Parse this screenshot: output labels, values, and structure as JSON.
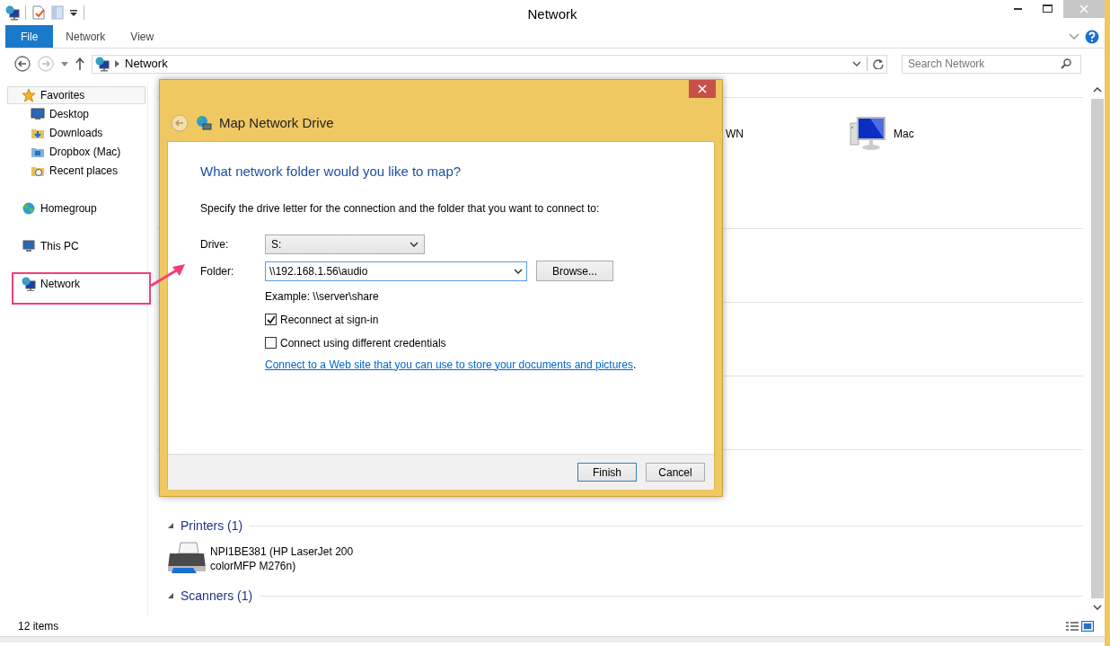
{
  "window": {
    "title": "Network"
  },
  "ribbon": {
    "tabs": [
      {
        "label": "File",
        "selected": true
      },
      {
        "label": "Network",
        "selected": false
      },
      {
        "label": "View",
        "selected": false
      }
    ]
  },
  "address_bar": {
    "location": "Network"
  },
  "search": {
    "placeholder": "Search Network"
  },
  "nav_pane": {
    "items": [
      {
        "label": "Favorites",
        "kind": "favorites",
        "selected": true,
        "children": [
          {
            "label": "Desktop",
            "kind": "desktop"
          },
          {
            "label": "Downloads",
            "kind": "downloads"
          },
          {
            "label": "Dropbox (Mac)",
            "kind": "dropbox"
          },
          {
            "label": "Recent places",
            "kind": "recent"
          }
        ]
      },
      {
        "label": "Homegroup",
        "kind": "homegroup",
        "selected": false
      },
      {
        "label": "This PC",
        "kind": "pc",
        "selected": false
      },
      {
        "label": "Network",
        "kind": "network",
        "selected": false
      }
    ]
  },
  "content": {
    "computers": [
      {
        "name": "WN",
        "kind": "text"
      },
      {
        "name": "Mac",
        "kind": "computer"
      }
    ],
    "groups": [
      {
        "title": "Printers (1)",
        "items": [
          {
            "name": "NPI1BE381 (HP LaserJet 200 colorMFP M276n)",
            "kind": "printer"
          }
        ]
      },
      {
        "title": "Scanners (1)"
      }
    ]
  },
  "status_bar": {
    "count": "12 items"
  },
  "dialog": {
    "title": "Map Network Drive",
    "heading": "What network folder would you like to map?",
    "instruction": "Specify the drive letter for the connection and the folder that you want to connect to:",
    "drive": {
      "label": "Drive:",
      "value": "S:"
    },
    "folder": {
      "label": "Folder:",
      "value": "\\\\192.168.1.56\\audio",
      "button": "Browse..."
    },
    "example": "Example: \\\\server\\share",
    "options": [
      {
        "label": "Reconnect at sign-in",
        "checked": true
      },
      {
        "label": "Connect using different credentials",
        "checked": false
      }
    ],
    "link": {
      "text": "Connect to a Web site that you can use to store your documents and pictures",
      "after": "."
    },
    "buttons": [
      {
        "label": "Finish",
        "default": true
      },
      {
        "label": "Cancel",
        "default": false
      }
    ]
  }
}
